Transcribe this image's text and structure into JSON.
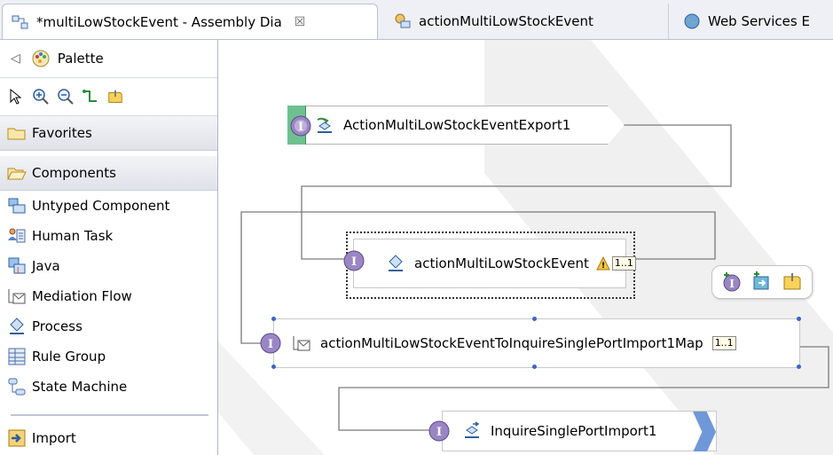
{
  "tabs": [
    {
      "label": "*multiLowStockEvent - Assembly Dia",
      "close": "☒",
      "icon": "assembly-diagram-icon"
    },
    {
      "label": "actionMultiLowStockEvent",
      "icon": "process-editor-icon"
    },
    {
      "label": "Web Services E",
      "icon": "globe-icon"
    }
  ],
  "palette": {
    "title": "Palette",
    "collapse_glyph": "◁",
    "tools": [
      "select-arrow-icon",
      "zoom-in-icon",
      "zoom-out-icon",
      "wire-tool-icon",
      "note-tool-icon"
    ],
    "drawers": {
      "favorites": "Favorites",
      "components": "Components"
    },
    "items": [
      {
        "label": "Untyped Component",
        "icon": "untyped-component-icon"
      },
      {
        "label": "Human Task",
        "icon": "human-task-icon"
      },
      {
        "label": "Java",
        "icon": "java-icon"
      },
      {
        "label": "Mediation Flow",
        "icon": "mediation-flow-icon"
      },
      {
        "label": "Process",
        "icon": "process-icon"
      },
      {
        "label": "Rule Group",
        "icon": "rule-group-icon"
      },
      {
        "label": "State Machine",
        "icon": "state-machine-icon"
      }
    ],
    "import_label": "Import"
  },
  "diagram": {
    "export_node": "ActionMultiLowStockEventExport1",
    "process_node": "actionMultiLowStockEvent",
    "map_node": "actionMultiLowStockEventToInquireSinglePortImport1Map",
    "import_node": "InquireSinglePortImport1",
    "interface_glyph": "I",
    "ref_label_1": "1..1",
    "ref_label_2": "1..1"
  },
  "colors": {
    "interface_badge": "#9a86c4",
    "export_accent": "#6fc08f",
    "import_accent": "#6f98d8",
    "wire": "#7a7a7a",
    "watermark": "#e8e8e8"
  }
}
